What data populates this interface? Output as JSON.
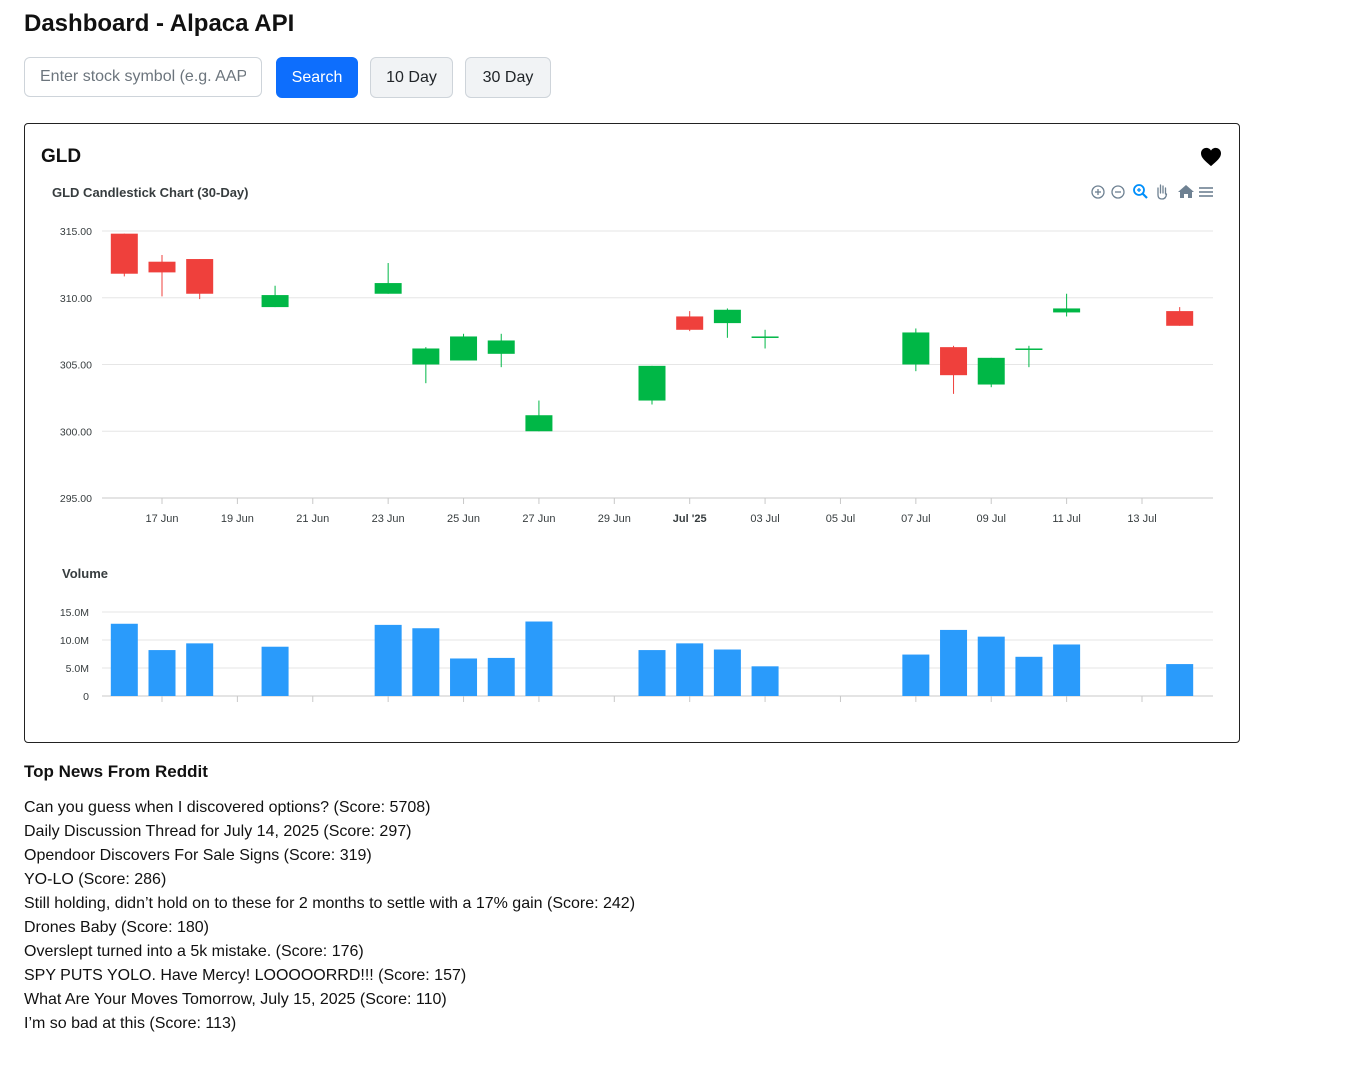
{
  "page": {
    "title": "Dashboard - Alpaca API"
  },
  "controls": {
    "search_placeholder": "Enter stock symbol (e.g. AAPL)",
    "search_label": "Search",
    "ten_day_label": "10 Day",
    "thirty_day_label": "30 Day"
  },
  "card": {
    "symbol": "GLD",
    "favorite_icon": "heart-icon",
    "toolbar_icons": [
      "zoom-in-icon",
      "zoom-out-icon",
      "zoom-selection-icon",
      "pan-icon",
      "reset-home-icon",
      "menu-icon"
    ]
  },
  "colors": {
    "up": "#00b746",
    "down": "#ef403c",
    "volume": "#2a9bfb",
    "primary": "#0d6efd"
  },
  "chart_data": [
    {
      "type": "candlestick",
      "title": "GLD Candlestick Chart (30-Day)",
      "ylim": [
        295,
        315
      ],
      "y_ticks": [
        "315.00",
        "310.00",
        "305.00",
        "300.00",
        "295.00"
      ],
      "x_range": [
        "2025-06-15",
        "2025-07-15"
      ],
      "x_ticks": [
        {
          "date": "2025-06-17",
          "label": "17 Jun"
        },
        {
          "date": "2025-06-19",
          "label": "19 Jun"
        },
        {
          "date": "2025-06-21",
          "label": "21 Jun"
        },
        {
          "date": "2025-06-23",
          "label": "23 Jun"
        },
        {
          "date": "2025-06-25",
          "label": "25 Jun"
        },
        {
          "date": "2025-06-27",
          "label": "27 Jun"
        },
        {
          "date": "2025-06-29",
          "label": "29 Jun"
        },
        {
          "date": "2025-07-01",
          "label": "Jul '25",
          "bold": true
        },
        {
          "date": "2025-07-03",
          "label": "03 Jul"
        },
        {
          "date": "2025-07-05",
          "label": "05 Jul"
        },
        {
          "date": "2025-07-07",
          "label": "07 Jul"
        },
        {
          "date": "2025-07-09",
          "label": "09 Jul"
        },
        {
          "date": "2025-07-11",
          "label": "11 Jul"
        },
        {
          "date": "2025-07-13",
          "label": "13 Jul"
        }
      ],
      "candles": [
        {
          "date": "2025-06-16",
          "open": 314.8,
          "high": 314.8,
          "low": 311.6,
          "close": 311.8
        },
        {
          "date": "2025-06-17",
          "open": 312.7,
          "high": 313.2,
          "low": 310.1,
          "close": 311.9
        },
        {
          "date": "2025-06-18",
          "open": 312.9,
          "high": 312.9,
          "low": 309.9,
          "close": 310.3
        },
        {
          "date": "2025-06-20",
          "open": 309.3,
          "high": 310.9,
          "low": 309.3,
          "close": 310.2
        },
        {
          "date": "2025-06-23",
          "open": 310.3,
          "high": 312.6,
          "low": 310.3,
          "close": 311.1
        },
        {
          "date": "2025-06-24",
          "open": 305.0,
          "high": 306.3,
          "low": 303.6,
          "close": 306.2
        },
        {
          "date": "2025-06-25",
          "open": 305.3,
          "high": 307.3,
          "low": 305.3,
          "close": 307.1
        },
        {
          "date": "2025-06-26",
          "open": 305.8,
          "high": 307.3,
          "low": 304.8,
          "close": 306.8
        },
        {
          "date": "2025-06-27",
          "open": 300.0,
          "high": 302.3,
          "low": 300.0,
          "close": 301.2
        },
        {
          "date": "2025-06-30",
          "open": 302.3,
          "high": 304.9,
          "low": 302.0,
          "close": 304.9
        },
        {
          "date": "2025-07-01",
          "open": 308.6,
          "high": 309.0,
          "low": 307.5,
          "close": 307.6
        },
        {
          "date": "2025-07-02",
          "open": 308.1,
          "high": 309.2,
          "low": 307.0,
          "close": 309.1
        },
        {
          "date": "2025-07-03",
          "open": 307.0,
          "high": 307.6,
          "low": 306.2,
          "close": 307.1
        },
        {
          "date": "2025-07-07",
          "open": 305.0,
          "high": 307.7,
          "low": 304.5,
          "close": 307.4
        },
        {
          "date": "2025-07-08",
          "open": 306.3,
          "high": 306.4,
          "low": 302.8,
          "close": 304.2
        },
        {
          "date": "2025-07-09",
          "open": 303.5,
          "high": 305.5,
          "low": 303.3,
          "close": 305.5
        },
        {
          "date": "2025-07-10",
          "open": 306.1,
          "high": 306.4,
          "low": 304.8,
          "close": 306.2
        },
        {
          "date": "2025-07-11",
          "open": 308.9,
          "high": 310.3,
          "low": 308.6,
          "close": 309.2
        },
        {
          "date": "2025-07-14",
          "open": 309.0,
          "high": 309.3,
          "low": 307.9,
          "close": 307.9
        }
      ]
    },
    {
      "type": "bar",
      "title": "Volume",
      "ylim": [
        0,
        15000000
      ],
      "y_ticks": [
        "15.0M",
        "10.0M",
        "5.0M",
        "0"
      ],
      "x_range": [
        "2025-06-15",
        "2025-07-15"
      ],
      "series": [
        {
          "dates": [
            "2025-06-16",
            "2025-06-17",
            "2025-06-18",
            "2025-06-20",
            "2025-06-23",
            "2025-06-24",
            "2025-06-25",
            "2025-06-26",
            "2025-06-27",
            "2025-06-30",
            "2025-07-01",
            "2025-07-02",
            "2025-07-03",
            "2025-07-07",
            "2025-07-08",
            "2025-07-09",
            "2025-07-10",
            "2025-07-11",
            "2025-07-14"
          ],
          "values": [
            12.9,
            8.2,
            9.4,
            8.8,
            12.7,
            12.1,
            6.7,
            6.8,
            13.3,
            8.2,
            9.4,
            8.3,
            5.3,
            7.4,
            11.8,
            10.6,
            7.0,
            9.2,
            5.7
          ]
        }
      ],
      "value_unit": "M"
    }
  ],
  "news": {
    "title": "Top News From Reddit",
    "items": [
      "Can you guess when I discovered options? (Score: 5708)",
      "Daily Discussion Thread for July 14, 2025 (Score: 297)",
      "Opendoor Discovers For Sale Signs (Score: 319)",
      "YO-LO (Score: 286)",
      "Still holding, didn’t hold on to these for 2 months to settle with a 17% gain (Score: 242)",
      "Drones Baby (Score: 180)",
      "Overslept turned into a 5k mistake. (Score: 176)",
      "SPY PUTS YOLO. Have Mercy! LOOOOORRD!!! (Score: 157)",
      "What Are Your Moves Tomorrow, July 15, 2025 (Score: 110)",
      "I’m so bad at this (Score: 113)"
    ]
  }
}
